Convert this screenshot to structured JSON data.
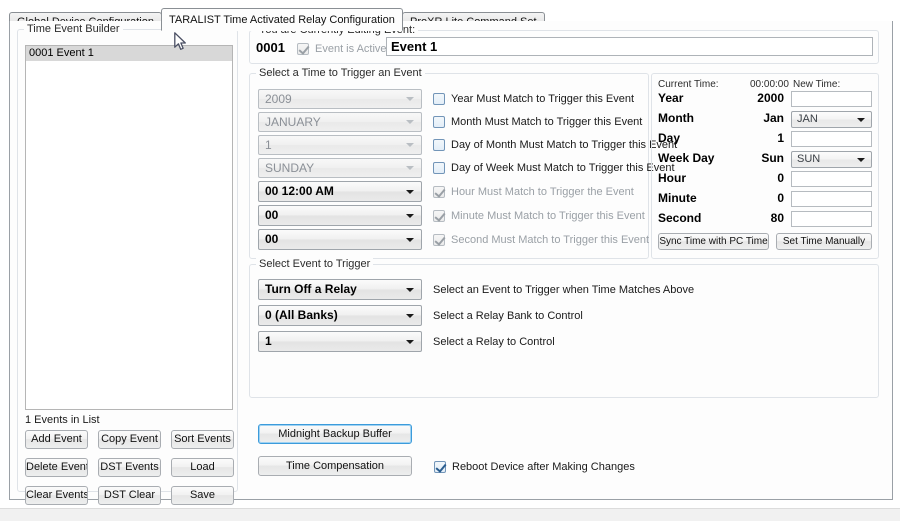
{
  "tabs": [
    {
      "label": "Global Device Configuration",
      "selected": false
    },
    {
      "label": "TARALIST Time Activated Relay Configuration",
      "selected": true
    },
    {
      "label": "ProXR Lite Command Set",
      "selected": false
    }
  ],
  "left_panel": {
    "title": "Time Event Builder",
    "list_items": [
      {
        "label": "0001 Event 1",
        "selected": true
      }
    ],
    "count_label": "1 Events in List",
    "buttons": [
      "Add Event",
      "Copy Event",
      "Sort Events",
      "Delete Event",
      "DST Events",
      "Load",
      "Clear Events",
      "DST Clear",
      "Save"
    ]
  },
  "editing": {
    "group_label": "You are Currently Editing Event:",
    "event_id": "0001",
    "active_checkbox_label": "Event is Active",
    "active_checked": true,
    "event_name_value": "Event 1"
  },
  "time_trigger": {
    "group_label": "Select a Time to Trigger an Event",
    "rows": [
      {
        "value": "2009",
        "checkbox": "Year Must Match to Trigger this Event",
        "checked": false,
        "disabled": true
      },
      {
        "value": "JANUARY",
        "checkbox": "Month Must Match to Trigger this Event",
        "checked": false,
        "disabled": true
      },
      {
        "value": "1",
        "checkbox": "Day of Month Must Match to Trigger this Event",
        "checked": false,
        "disabled": true
      },
      {
        "value": "SUNDAY",
        "checkbox": "Day of Week Must Match to Trigger this Event",
        "checked": false,
        "disabled": true
      },
      {
        "value": "00   12:00 AM",
        "checkbox": "Hour Must Match to Trigger the Event",
        "checked": true,
        "disabled": false
      },
      {
        "value": "00",
        "checkbox": "Minute Must Match to Trigger this Event",
        "checked": true,
        "disabled": false
      },
      {
        "value": "00",
        "checkbox": "Second Must Match to Trigger this Event",
        "checked": true,
        "disabled": false
      }
    ]
  },
  "clock": {
    "current_time_label": "Current Time:",
    "current_time_value": "00:00:00",
    "new_time_label": "New Time:",
    "rows": [
      {
        "label": "Year",
        "value": "2000",
        "field": "input",
        "field_value": ""
      },
      {
        "label": "Month",
        "value": "Jan",
        "field": "combo",
        "field_value": "JAN"
      },
      {
        "label": "Day",
        "value": "1",
        "field": "input",
        "field_value": ""
      },
      {
        "label": "Week Day",
        "value": "Sun",
        "field": "combo",
        "field_value": "SUN"
      },
      {
        "label": "Hour",
        "value": "0",
        "field": "input",
        "field_value": ""
      },
      {
        "label": "Minute",
        "value": "0",
        "field": "input",
        "field_value": ""
      },
      {
        "label": "Second",
        "value": "80",
        "field": "input",
        "field_value": ""
      }
    ],
    "sync_button": "Sync Time with PC Time",
    "set_button": "Set Time Manually"
  },
  "event_trigger": {
    "group_label": "Select Event to Trigger",
    "rows": [
      {
        "value": "Turn Off a Relay",
        "hint": "Select an Event to Trigger when Time Matches Above"
      },
      {
        "value": "0 (All Banks)",
        "hint": "Select a Relay Bank to Control"
      },
      {
        "value": "1",
        "hint": "Select a Relay to Control"
      }
    ]
  },
  "actions": {
    "midnight_button": "Midnight Backup Buffer",
    "time_comp_button": "Time Compensation",
    "reboot_checkbox": "Reboot Device after Making Changes",
    "reboot_checked": true
  },
  "colors": {
    "focus_blue": "#3c9bdb",
    "selection_gray": "#d8d8d8",
    "panel_bg": "#fdfdfd"
  }
}
